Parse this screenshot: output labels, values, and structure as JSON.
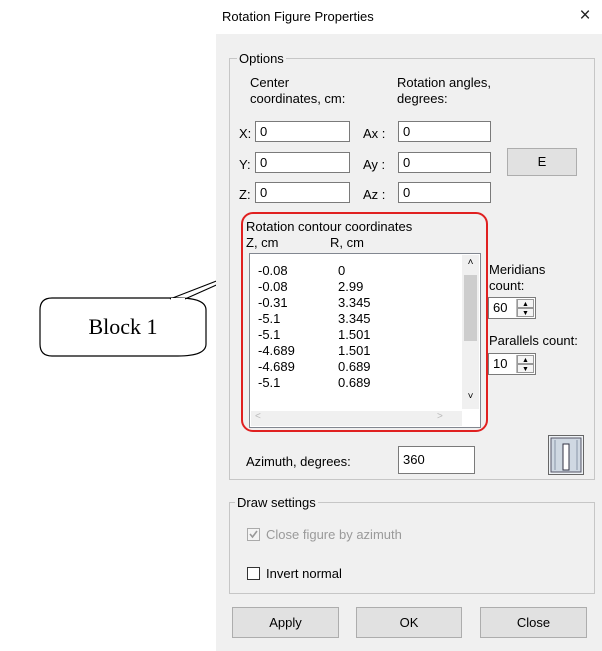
{
  "window": {
    "title": "Rotation Figure Properties",
    "close_glyph": "×"
  },
  "options": {
    "legend": "Options",
    "center_label_1": "Center",
    "center_label_2": "coordinates, cm:",
    "rotation_label_1": "Rotation angles,",
    "rotation_label_2": "degrees:",
    "x_label": "X:",
    "x_value": "0",
    "y_label": "Y:",
    "y_value": "0",
    "z_label": "Z:",
    "z_value": "0",
    "ax_label": "Ax :",
    "ax_value": "0",
    "ay_label": "Ay :",
    "ay_value": "0",
    "az_label": "Az :",
    "az_value": "0",
    "e_button": "E",
    "contour_title": "Rotation contour coordinates",
    "col_z": "Z, cm",
    "col_r": "R, cm",
    "rows": [
      {
        "z": "-0.08",
        "r": "0"
      },
      {
        "z": "-0.08",
        "r": "2.99"
      },
      {
        "z": "-0.31",
        "r": "3.345"
      },
      {
        "z": "-5.1",
        "r": "3.345"
      },
      {
        "z": "-5.1",
        "r": "1.501"
      },
      {
        "z": "-4.689",
        "r": "1.501"
      },
      {
        "z": "-4.689",
        "r": "0.689"
      },
      {
        "z": "-5.1",
        "r": "0.689"
      }
    ],
    "meridians_label_1": "Meridians",
    "meridians_label_2": "count:",
    "meridians_value": "60",
    "parallels_label": "Parallels count:",
    "parallels_value": "10",
    "azimuth_label": "Azimuth, degrees:",
    "azimuth_value": "360"
  },
  "draw_settings": {
    "legend": "Draw settings",
    "close_figure_label": "Close figure by azimuth",
    "close_figure_checked": true,
    "invert_normal_label": "Invert normal",
    "invert_normal_checked": false
  },
  "buttons": {
    "apply": "Apply",
    "ok": "OK",
    "close": "Close"
  },
  "annotation": {
    "callout_text": "Block 1",
    "highlight_color": "#e02020"
  }
}
